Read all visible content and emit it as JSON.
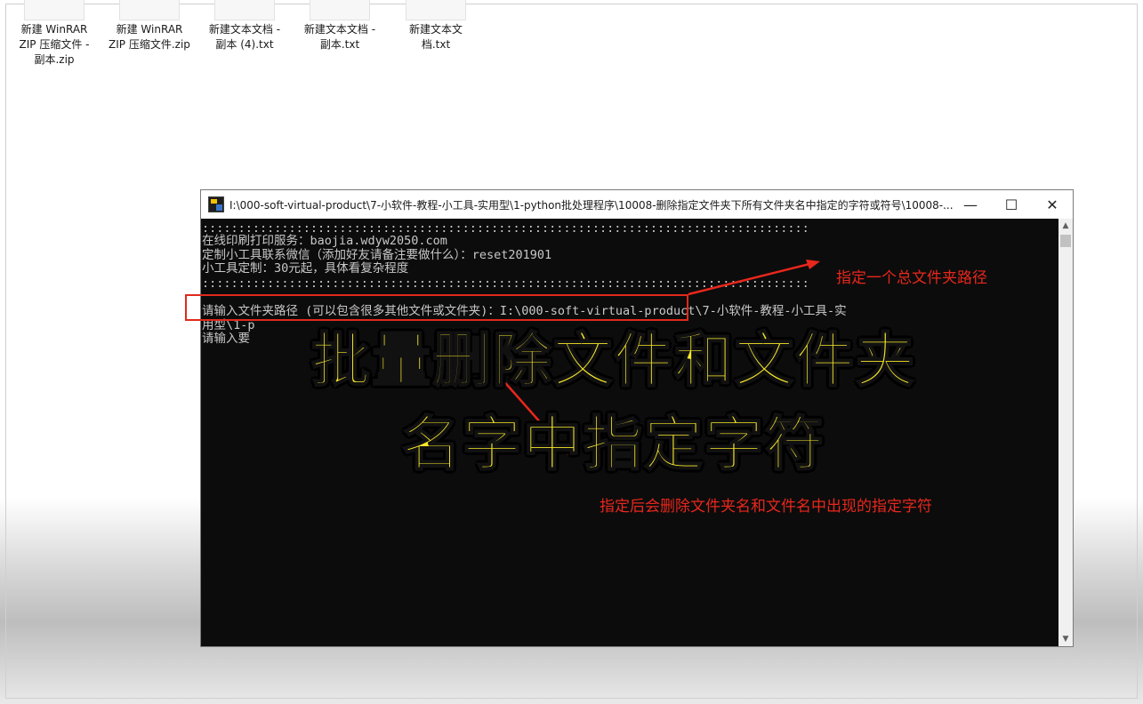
{
  "desktop": {
    "files": [
      {
        "label": "新建 WinRAR ZIP 压缩文件 - 副本.zip"
      },
      {
        "label": "新建 WinRAR ZIP 压缩文件.zip"
      },
      {
        "label": "新建文本文档 - 副本 (4).txt"
      },
      {
        "label": "新建文本文档 - 副本.txt"
      },
      {
        "label": "新建文本文档.txt"
      }
    ]
  },
  "console": {
    "title": "I:\\000-soft-virtual-product\\7-小软件-教程-小工具-实用型\\1-python批处理程序\\10008-删除指定文件夹下所有文件夹名中指定的字符或符号\\10008-...",
    "minimize_glyph": "—",
    "maximize_glyph": "☐",
    "close_glyph": "✕",
    "lines": [
      "::::::::::::::::::::::::::::::::::::::::::::::::::::::::::::::::::::::::::::::::::::",
      "在线印刷打印服务：baojia.wdyw2050.com",
      "定制小工具联系微信（添加好友请备注要做什么）：reset201901",
      "小工具定制：30元起，具体看复杂程度",
      "::::::::::::::::::::::::::::::::::::::::::::::::::::::::::::::::::::::::::::::::::::",
      "请输入文件夹路径 (可以包含很多其他文件或文件夹)：I:\\000-soft-virtual-product\\7-小软件-教程-小工具-实",
      "用型\\1-p",
      "请输入要"
    ],
    "scroll_up_glyph": "▲",
    "scroll_down_glyph": "▼"
  },
  "overlay": {
    "annotation_path": "指定一个总文件夹路径",
    "annotation_chars": "指定后会删除文件夹名和文件名中出现的指定字符",
    "headline_line1": "批量删除文件和文件夹",
    "headline_line2": "名字中指定字符"
  },
  "colors": {
    "annotation_red": "#e8271c",
    "headline_yellow": "#f9e928",
    "console_bg": "#0c0c0c",
    "console_text": "#c8c8c8"
  }
}
